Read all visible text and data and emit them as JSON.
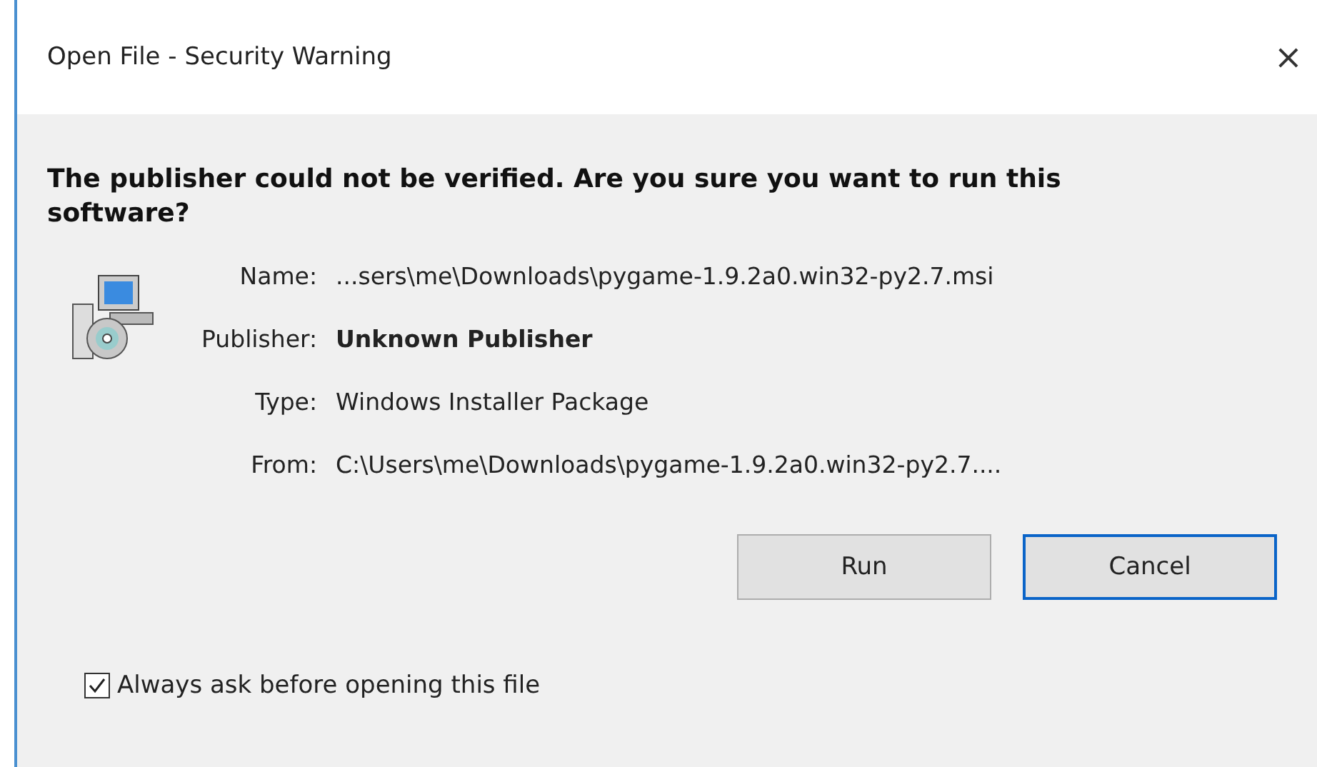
{
  "window": {
    "title": "Open File - Security Warning",
    "close": "×"
  },
  "heading": "The publisher could not be verified.  Are you sure you want to run this software?",
  "details": [
    {
      "label": "Name:",
      "value": "...sers\\me\\Downloads\\pygame-1.9.2a0.win32-py2.7.msi",
      "bold": false
    },
    {
      "label": "Publisher:",
      "value": "Unknown Publisher",
      "bold": true
    },
    {
      "label": "Type:",
      "value": "Windows Installer Package",
      "bold": false
    },
    {
      "label": "From:",
      "value": "C:\\Users\\me\\Downloads\\pygame-1.9.2a0.win32-py2.7....",
      "bold": false
    }
  ],
  "buttons": [
    {
      "label": "Run",
      "focused": false
    },
    {
      "label": "Cancel",
      "focused": true
    }
  ],
  "checkbox": {
    "label": "Always ask before opening this file",
    "checked": true
  }
}
